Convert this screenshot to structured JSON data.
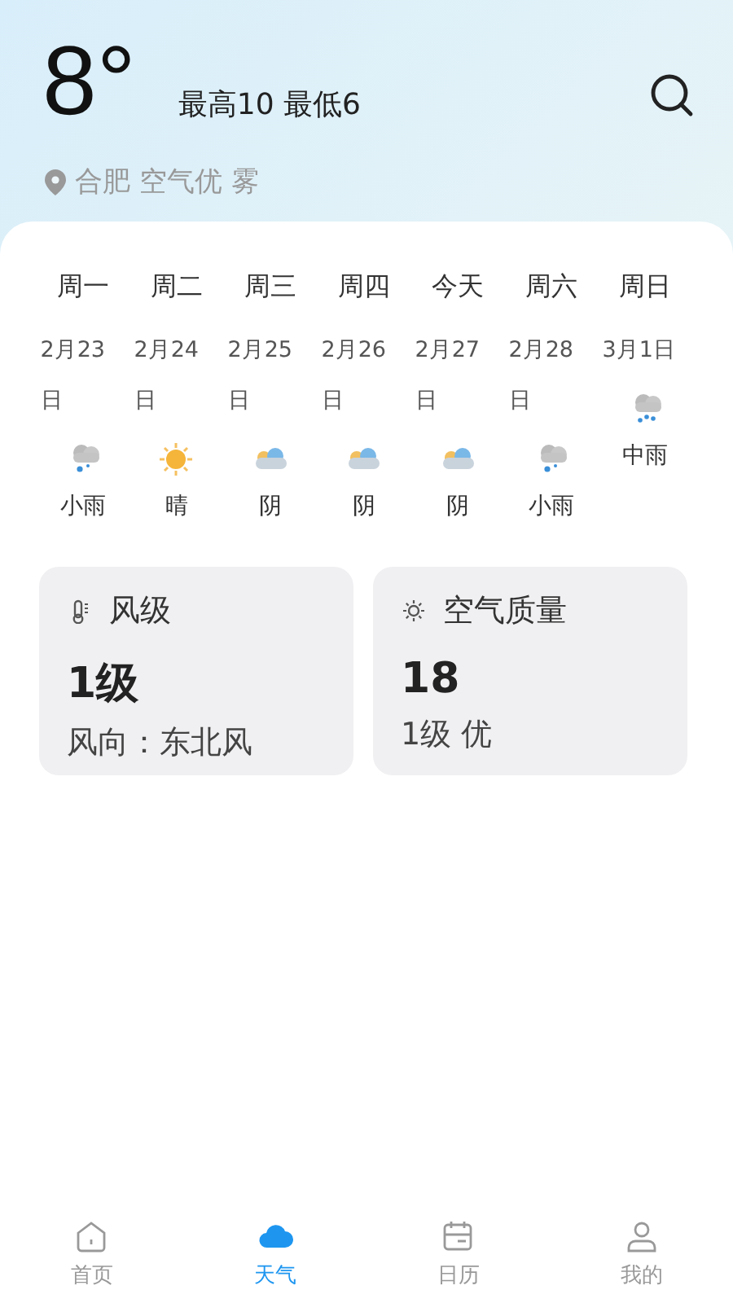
{
  "header": {
    "temperature": "8°",
    "range": "最高10 最低6",
    "location": "合肥 空气优 雾"
  },
  "forecast": [
    {
      "day": "周一",
      "date": "2月23日",
      "kind": "light_rain",
      "condition": "小雨"
    },
    {
      "day": "周二",
      "date": "2月24日",
      "kind": "sunny",
      "condition": "晴"
    },
    {
      "day": "周三",
      "date": "2月25日",
      "kind": "overcast",
      "condition": "阴"
    },
    {
      "day": "周四",
      "date": "2月26日",
      "kind": "overcast",
      "condition": "阴"
    },
    {
      "day": "今天",
      "date": "2月27日",
      "kind": "overcast",
      "condition": "阴"
    },
    {
      "day": "周六",
      "date": "2月28日",
      "kind": "light_rain",
      "condition": "小雨"
    },
    {
      "day": "周日",
      "date": "3月1日",
      "kind": "moderate_rain",
      "condition": "中雨"
    }
  ],
  "cards": [
    {
      "kind": "wind",
      "title": "风级",
      "value": "1级",
      "detail": "风向：东北风"
    },
    {
      "kind": "air",
      "title": "空气质量",
      "value": "18",
      "detail": "1级 优"
    }
  ],
  "tab_bar": [
    {
      "kind": "home",
      "label": "首页",
      "selected": false
    },
    {
      "kind": "weather",
      "label": "天气",
      "selected": true
    },
    {
      "kind": "calendar",
      "label": "日历",
      "selected": false
    },
    {
      "kind": "profile",
      "label": "我的",
      "selected": false
    }
  ]
}
